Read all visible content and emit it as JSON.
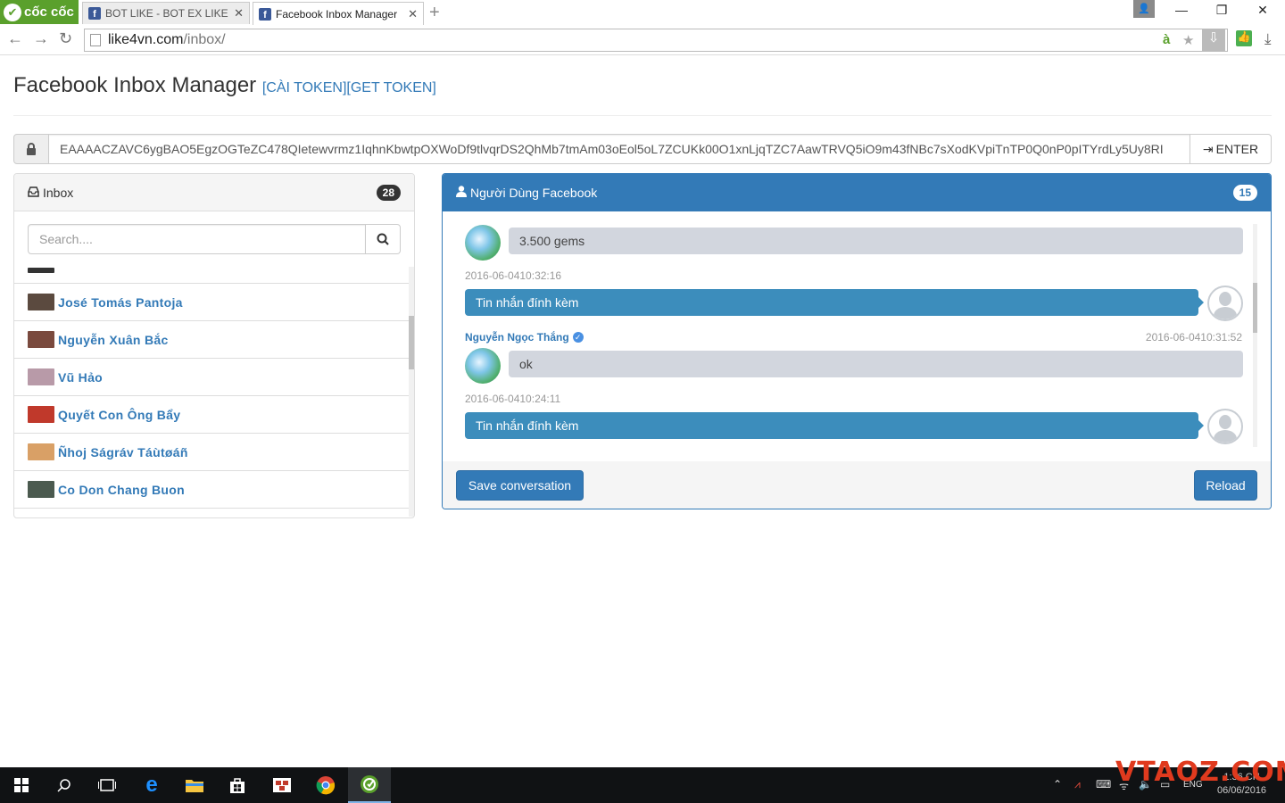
{
  "browser": {
    "brand": "cốc cốc",
    "tabs": [
      {
        "title": "BOT LIKE - BOT EX LIKE - B",
        "close": "✕"
      },
      {
        "title": "Facebook Inbox Manager",
        "close": "✕"
      }
    ],
    "new_tab": "+",
    "url_host": "like4vn.com",
    "url_path": "/inbox/"
  },
  "page": {
    "title": "Facebook Inbox Manager",
    "links": "[CÀI TOKEN][GET TOKEN]",
    "token": "EAAAACZAVC6ygBAO5EgzOGTeZC478QIetewvrmz1IqhnKbwtpOXWoDf9tlvqrDS2QhMb7tmAm03oEol5oL7ZCUKk00O1xnLjqTZC7AawTRVQ5iO9m43fNBc7sXodKVpiTnTP0Q0nP0pITYrdLy5Uy8RI",
    "enter_label": "ENTER"
  },
  "inbox": {
    "title": "Inbox",
    "count": "28",
    "search_placeholder": "Search....",
    "contacts": [
      {
        "name": "José Tomás Pantoja",
        "avatar_color": "#5b4a3f"
      },
      {
        "name": "Nguyễn Xuân Bắc",
        "avatar_color": "#7a4a3e"
      },
      {
        "name": "Vũ Hảo",
        "avatar_color": "#b89aa8"
      },
      {
        "name": "Quyết Con Ông Bẩy",
        "avatar_color": "#c0392b"
      },
      {
        "name": "Ñhoj Ságráv Táùtøáñ",
        "avatar_color": "#d9a066"
      },
      {
        "name": "Co Don Chang Buon",
        "avatar_color": "#4b5a4f"
      }
    ]
  },
  "chat": {
    "title": "Người Dùng Facebook",
    "count": "15",
    "messages": [
      {
        "text": "3.500 gems"
      },
      {
        "time": "2016-06-0410:32:16"
      },
      {
        "text": "Tin nhắn đính kèm"
      },
      {
        "sender": "Nguyễn Ngọc Thắng",
        "time": "2016-06-0410:31:52"
      },
      {
        "text": "ok"
      },
      {
        "time": "2016-06-0410:24:11"
      },
      {
        "text": "Tin nhắn đính kèm"
      }
    ],
    "save_label": "Save conversation",
    "reload_label": "Reload"
  },
  "taskbar": {
    "language": "ENG",
    "time": "1:36 CH",
    "date": "06/06/2016",
    "watermark": "VTAOZ.COM"
  },
  "colors": {
    "primary": "#337ab7",
    "bubble_out": "#3c8dbc",
    "bubble_in": "#d2d6de",
    "brand_green": "#5aa02c"
  }
}
